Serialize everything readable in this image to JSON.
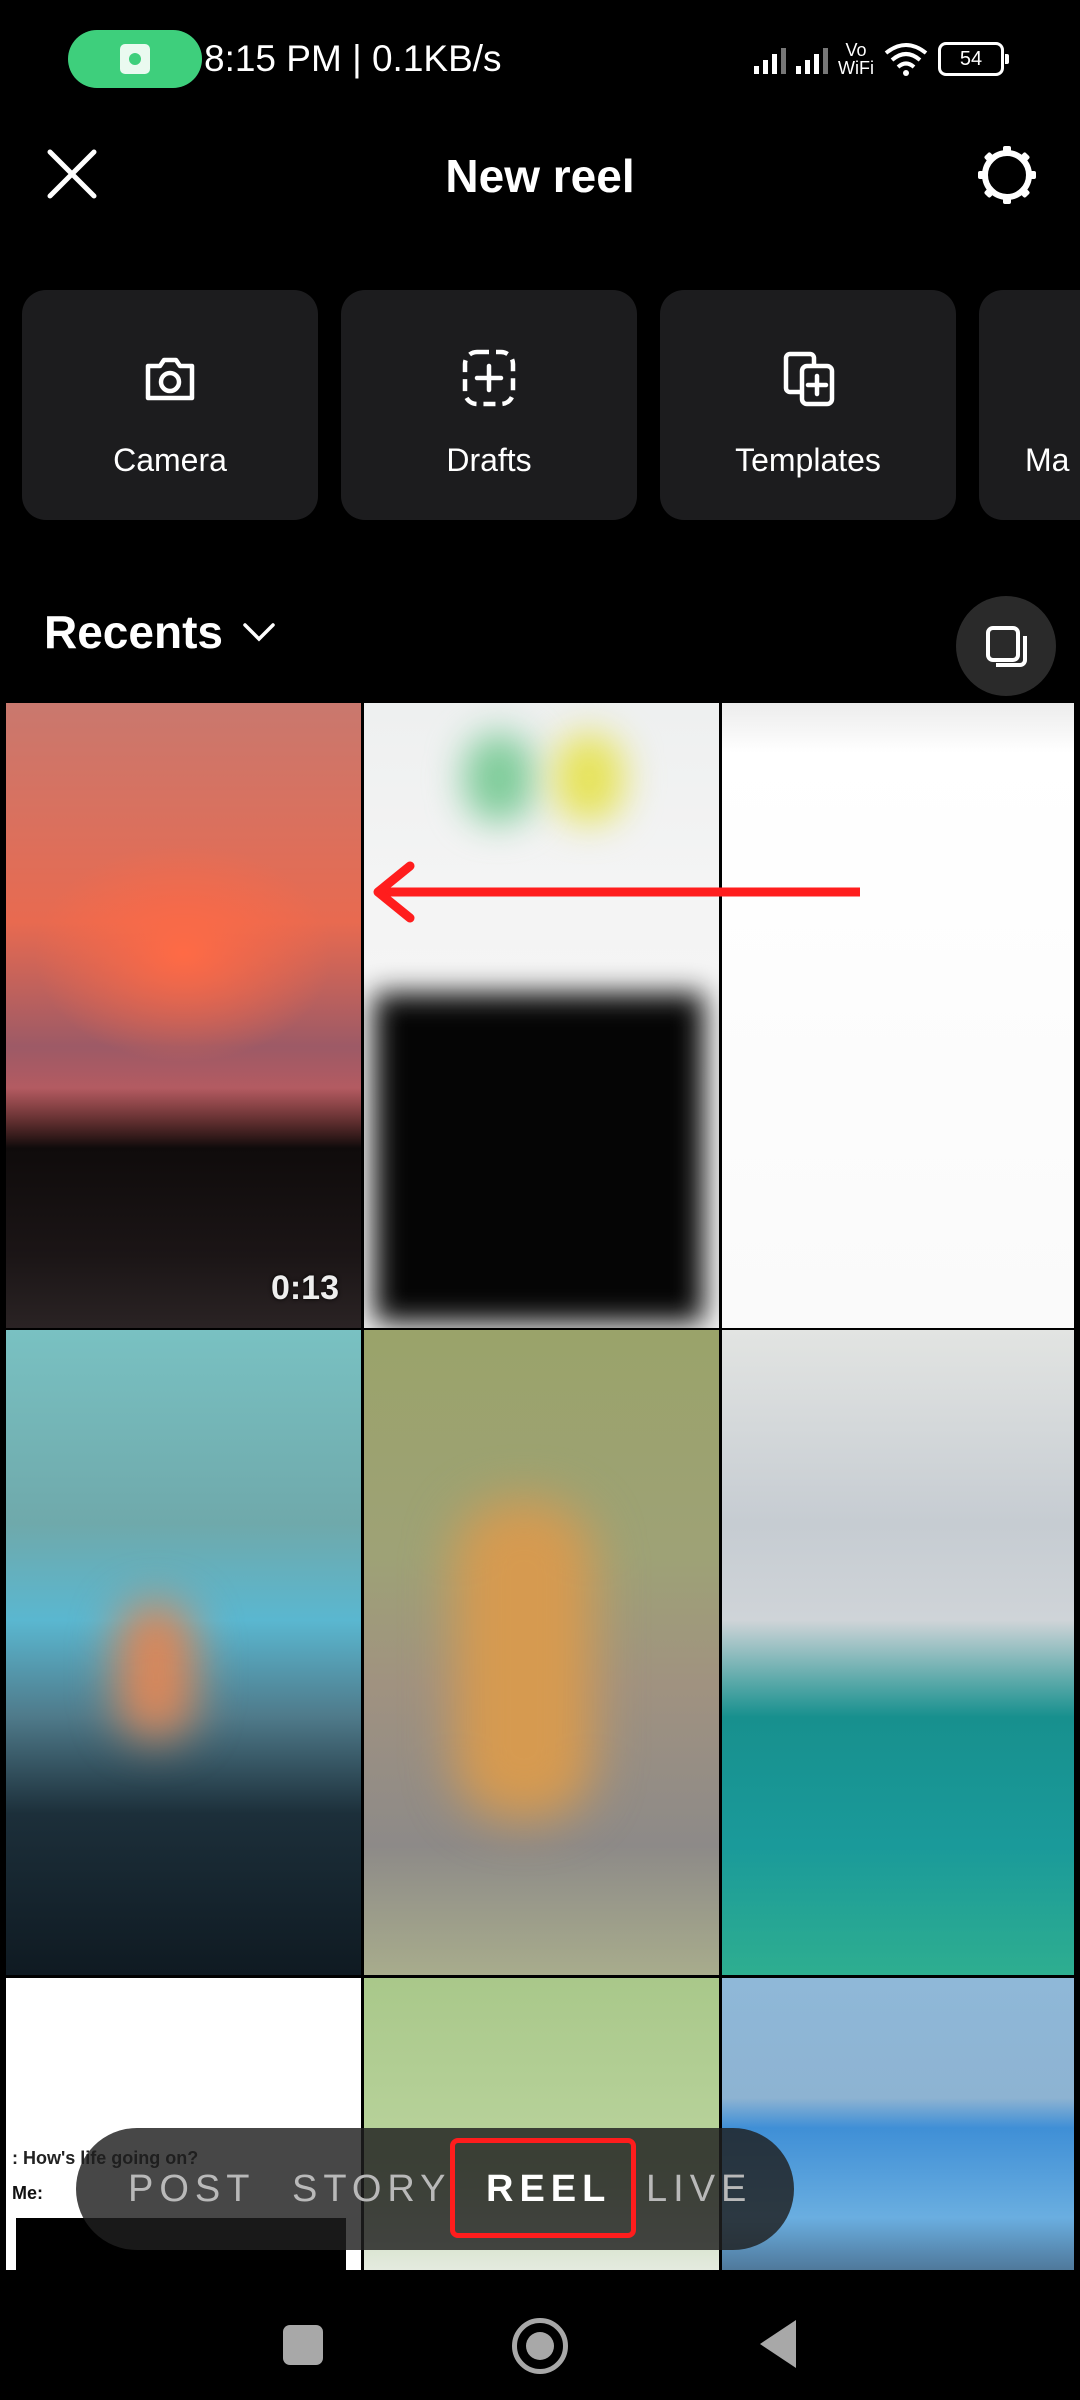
{
  "status_bar": {
    "time_speed": "8:15 PM | 0.1KB/s",
    "vowifi_top": "Vo",
    "vowifi_bottom": "WiFi",
    "battery": "54",
    "recording_color": "#3ecf7c"
  },
  "header": {
    "title": "New reel",
    "close_icon": "close-icon",
    "settings_icon": "gear-icon"
  },
  "tiles": [
    {
      "label": "Camera",
      "icon": "camera-icon"
    },
    {
      "label": "Drafts",
      "icon": "drafts-icon"
    },
    {
      "label": "Templates",
      "icon": "templates-icon"
    },
    {
      "label": "Ma",
      "icon": "none"
    }
  ],
  "gallery": {
    "album_label": "Recents",
    "select_multiple_icon": "select-multiple-icon",
    "items": [
      {
        "duration": "0:13",
        "kind": "video"
      },
      {
        "kind": "image"
      },
      {
        "kind": "image"
      },
      {
        "kind": "image"
      },
      {
        "kind": "image"
      },
      {
        "kind": "image"
      },
      {
        "kind": "image",
        "chat_text": ": How's life going on?",
        "me_label": "Me:"
      },
      {
        "kind": "image"
      },
      {
        "kind": "image"
      }
    ]
  },
  "annotation": {
    "arrow_color": "#ff1d1d",
    "highlight_color": "#ff1d1d"
  },
  "modes": {
    "items": [
      "POST",
      "STORY",
      "REEL",
      "LIVE"
    ],
    "selected": "REEL"
  },
  "navbar": {
    "recents": "recents-icon",
    "home": "home-icon",
    "back": "back-icon"
  }
}
